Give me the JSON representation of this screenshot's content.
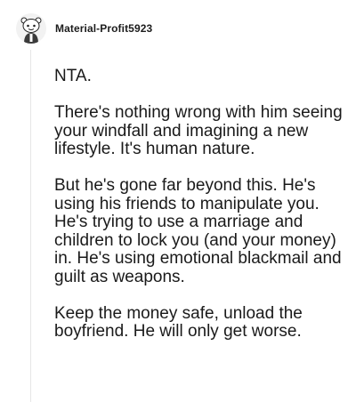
{
  "comment": {
    "username": "Material-Profit5923",
    "avatar_icon": "snoo-avatar-icon",
    "paragraphs": [
      "NTA.",
      "There's nothing wrong with him seeing your windfall and imagining a new lifestyle. It's human nature.",
      "But he's gone far beyond this. He's using his friends to manipulate you. He's trying to use a marriage and children to lock you (and your money) in. He's using emotional blackmail and guilt as weapons.",
      "Keep the money safe, unload the boyfriend. He will only get worse."
    ]
  }
}
